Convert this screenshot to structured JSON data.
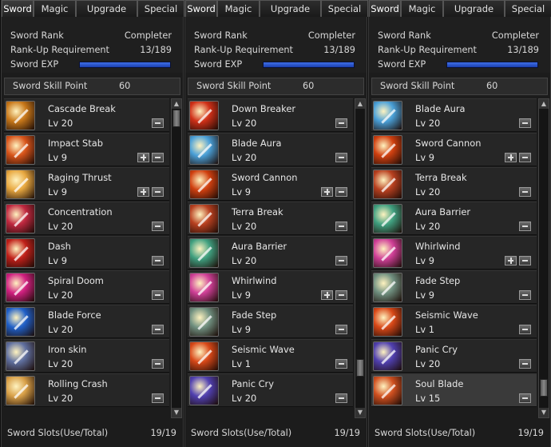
{
  "tabs": [
    "Sword",
    "Magic",
    "Upgrade",
    "Special"
  ],
  "info": {
    "rank_label": "Sword Rank",
    "rank_value": "Completer",
    "req_label": "Rank-Up Requirement",
    "req_value": "13/189",
    "exp_label": "Sword EXP",
    "exp_fraction": 1.0
  },
  "skill_point": {
    "label": "Sword Skill Point",
    "value": "60"
  },
  "footer": {
    "label": "Sword Slots(Use/Total)",
    "value": "19/19"
  },
  "panels": [
    {
      "skills": [
        {
          "name": "Cascade Break",
          "level": "Lv 20",
          "icon": "cascade-break-icon",
          "color": "#c8781a",
          "plus": false
        },
        {
          "name": "Impact Stab",
          "level": "Lv 9",
          "icon": "impact-stab-icon",
          "color": "#d8541a",
          "plus": true
        },
        {
          "name": "Raging Thrust",
          "level": "Lv 9",
          "icon": "raging-thrust-icon",
          "color": "#e8a840",
          "plus": true
        },
        {
          "name": "Concentration",
          "level": "Lv 20",
          "icon": "concentration-icon",
          "color": "#c02840",
          "plus": false
        },
        {
          "name": "Dash",
          "level": "Lv 9",
          "icon": "dash-icon",
          "color": "#c0201a",
          "plus": false
        },
        {
          "name": "Spiral Doom",
          "level": "Lv 20",
          "icon": "spiral-doom-icon",
          "color": "#d02080",
          "plus": false
        },
        {
          "name": "Blade Force",
          "level": "Lv 20",
          "icon": "blade-force-icon",
          "color": "#2060c8",
          "plus": false
        },
        {
          "name": "Iron skin",
          "level": "Lv 20",
          "icon": "iron-skin-icon",
          "color": "#6070a0",
          "plus": false
        },
        {
          "name": "Rolling Crash",
          "level": "Lv 20",
          "icon": "rolling-crash-icon",
          "color": "#d8a048",
          "plus": false
        }
      ]
    },
    {
      "skills": [
        {
          "name": "Down Breaker",
          "level": "Lv 20",
          "icon": "down-breaker-icon",
          "color": "#d03018",
          "plus": false
        },
        {
          "name": "Blade Aura",
          "level": "Lv 20",
          "icon": "blade-aura-icon",
          "color": "#4aa0d8",
          "plus": false
        },
        {
          "name": "Sword Cannon",
          "level": "Lv 9",
          "icon": "sword-cannon-icon",
          "color": "#d04010",
          "plus": true
        },
        {
          "name": "Terra Break",
          "level": "Lv 20",
          "icon": "terra-break-icon",
          "color": "#b84020",
          "plus": false
        },
        {
          "name": "Aura Barrier",
          "level": "Lv 20",
          "icon": "aura-barrier-icon",
          "color": "#40a080",
          "plus": false
        },
        {
          "name": "Whirlwind",
          "level": "Lv 9",
          "icon": "whirlwind-icon",
          "color": "#d04098",
          "plus": true
        },
        {
          "name": "Fade Step",
          "level": "Lv 9",
          "icon": "fade-step-icon",
          "color": "#709080",
          "plus": false
        },
        {
          "name": "Seismic Wave",
          "level": "Lv 1",
          "icon": "seismic-wave-icon",
          "color": "#d84818",
          "plus": false
        },
        {
          "name": "Panic Cry",
          "level": "Lv 20",
          "icon": "panic-cry-icon",
          "color": "#5040b0",
          "plus": false
        }
      ]
    },
    {
      "skills": [
        {
          "name": "Blade Aura",
          "level": "Lv 20",
          "icon": "blade-aura-icon",
          "color": "#4aa0d8",
          "plus": false
        },
        {
          "name": "Sword Cannon",
          "level": "Lv 9",
          "icon": "sword-cannon-icon",
          "color": "#d04010",
          "plus": true
        },
        {
          "name": "Terra Break",
          "level": "Lv 20",
          "icon": "terra-break-icon",
          "color": "#b84020",
          "plus": false
        },
        {
          "name": "Aura Barrier",
          "level": "Lv 20",
          "icon": "aura-barrier-icon",
          "color": "#40a080",
          "plus": false
        },
        {
          "name": "Whirlwind",
          "level": "Lv 9",
          "icon": "whirlwind-icon",
          "color": "#d04098",
          "plus": true
        },
        {
          "name": "Fade Step",
          "level": "Lv 9",
          "icon": "fade-step-icon",
          "color": "#709080",
          "plus": false
        },
        {
          "name": "Seismic Wave",
          "level": "Lv 1",
          "icon": "seismic-wave-icon",
          "color": "#d84818",
          "plus": false
        },
        {
          "name": "Panic Cry",
          "level": "Lv 20",
          "icon": "panic-cry-icon",
          "color": "#5040b0",
          "plus": false
        },
        {
          "name": "Soul Blade",
          "level": "Lv 15",
          "icon": "soul-blade-icon",
          "color": "#d05020",
          "plus": false,
          "selected": true
        }
      ]
    }
  ]
}
